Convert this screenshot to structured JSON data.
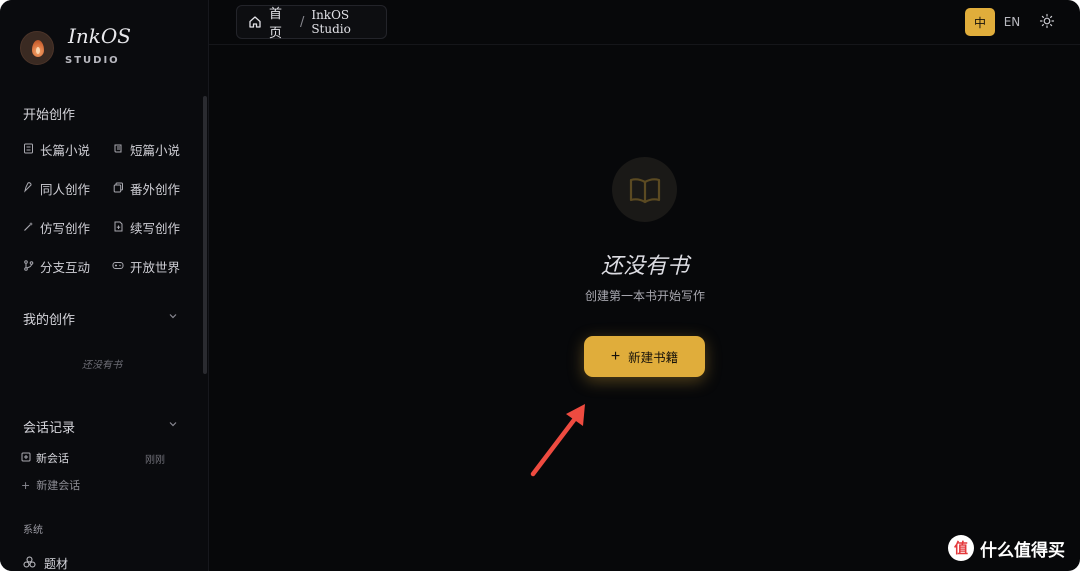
{
  "brand": {
    "name": "InkOS",
    "sub": "STUDIO"
  },
  "sidebar": {
    "create_title": "开始创作",
    "create_items": [
      {
        "label": "长篇小说",
        "icon": "book-icon"
      },
      {
        "label": "短篇小说",
        "icon": "scroll-icon"
      },
      {
        "label": "同人创作",
        "icon": "feather-icon"
      },
      {
        "label": "番外创作",
        "icon": "copy-icon"
      },
      {
        "label": "仿写创作",
        "icon": "wand-icon"
      },
      {
        "label": "续写创作",
        "icon": "file-plus-icon"
      },
      {
        "label": "分支互动",
        "icon": "branch-icon"
      },
      {
        "label": "开放世界",
        "icon": "gamepad-icon"
      }
    ],
    "my_works_title": "我的创作",
    "my_works_empty": "还没有书",
    "sessions_title": "会话记录",
    "session_item": {
      "label": "新会话",
      "time": "刚刚"
    },
    "new_session": "新建会话",
    "system_label": "系统",
    "topic_label": "题材"
  },
  "topbar": {
    "home": "首页",
    "separator": "/",
    "current": "InkOS Studio",
    "lang_zh": "中",
    "lang_en": "EN",
    "accent": "#e0ad3b"
  },
  "main": {
    "empty_title": "还没有书",
    "empty_subtitle": "创建第一本书开始写作",
    "new_book_button": "新建书籍"
  },
  "watermark": {
    "badge": "值",
    "text": "什么值得买"
  }
}
